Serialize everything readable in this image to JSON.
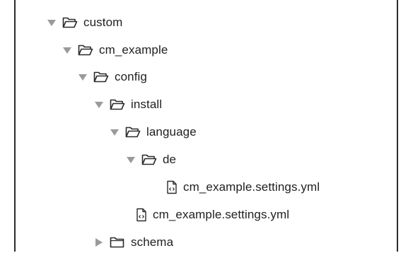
{
  "tree": {
    "items": [
      {
        "label": "custom",
        "type": "folder",
        "state": "expanded",
        "arrow_icon": "disclosure-down-icon",
        "icon": "folder-open-icon"
      },
      {
        "label": "cm_example",
        "type": "folder",
        "state": "expanded",
        "arrow_icon": "disclosure-down-icon",
        "icon": "folder-open-icon"
      },
      {
        "label": "config",
        "type": "folder",
        "state": "expanded",
        "arrow_icon": "disclosure-down-icon",
        "icon": "folder-open-icon"
      },
      {
        "label": "install",
        "type": "folder",
        "state": "expanded",
        "arrow_icon": "disclosure-down-icon",
        "icon": "folder-open-icon"
      },
      {
        "label": "language",
        "type": "folder",
        "state": "expanded",
        "arrow_icon": "disclosure-down-icon",
        "icon": "folder-open-icon"
      },
      {
        "label": "de",
        "type": "folder",
        "state": "expanded",
        "arrow_icon": "disclosure-down-icon",
        "icon": "folder-open-icon"
      },
      {
        "label": "cm_example.settings.yml",
        "type": "file",
        "icon": "code-file-icon"
      },
      {
        "label": "cm_example.settings.yml",
        "type": "file",
        "icon": "code-file-icon"
      },
      {
        "label": "schema",
        "type": "folder",
        "state": "collapsed",
        "arrow_icon": "disclosure-right-icon",
        "icon": "folder-closed-icon"
      }
    ]
  },
  "colors": {
    "arrow": "#9a9a9a",
    "icon_stroke": "#2a2a2a",
    "text": "#1f1f1f",
    "frame_border": "#2b2b2b"
  }
}
